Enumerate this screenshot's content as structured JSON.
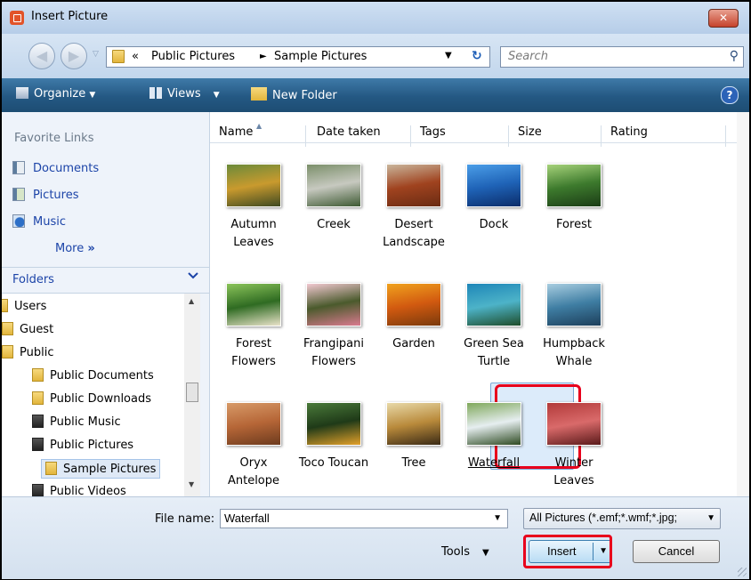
{
  "window": {
    "title": "Insert Picture",
    "close_glyph": "✕"
  },
  "address": {
    "prefix": "«",
    "crumbs": [
      "Public Pictures",
      "Sample Pictures"
    ],
    "separator": "►",
    "search_placeholder": "Search"
  },
  "toolbar": {
    "organize": "Organize",
    "views": "Views",
    "new_folder": "New Folder",
    "help": "?"
  },
  "sidebar": {
    "favorites_title": "Favorite Links",
    "favorites": [
      {
        "label": "Documents",
        "icon": "documents-icon"
      },
      {
        "label": "Pictures",
        "icon": "pictures-icon"
      },
      {
        "label": "Music",
        "icon": "music-icon"
      }
    ],
    "more": "More",
    "more_glyph": "»",
    "folders_title": "Folders",
    "tree": [
      {
        "label": "Users",
        "level": 0
      },
      {
        "label": "Guest",
        "level": 1
      },
      {
        "label": "Public",
        "level": 1
      },
      {
        "label": "Public Documents",
        "level": 2
      },
      {
        "label": "Public Downloads",
        "level": 2
      },
      {
        "label": "Public Music",
        "level": 2
      },
      {
        "label": "Public Pictures",
        "level": 2
      },
      {
        "label": "Sample Pictures",
        "level": 3,
        "selected": true
      },
      {
        "label": "Public Videos",
        "level": 2
      }
    ]
  },
  "columns": [
    "Name",
    "Date taken",
    "Tags",
    "Size",
    "Rating"
  ],
  "files": [
    {
      "label": "Autumn Leaves",
      "colors": [
        "#6b8a3a",
        "#c99a2e",
        "#3f4a22"
      ]
    },
    {
      "label": "Creek",
      "colors": [
        "#7b8f6a",
        "#c7c9c0",
        "#3e5a33"
      ]
    },
    {
      "label": "Desert Landscape",
      "colors": [
        "#c9b59b",
        "#a0431f",
        "#6a2b13"
      ]
    },
    {
      "label": "Dock",
      "colors": [
        "#4b9ee8",
        "#1f63b7",
        "#0b2d6a"
      ]
    },
    {
      "label": "Forest",
      "colors": [
        "#a6d27a",
        "#3d7a2d",
        "#1b3c16"
      ]
    },
    {
      "label": "Forest Flowers",
      "colors": [
        "#8bc45a",
        "#2f6b22",
        "#e9e2c9"
      ]
    },
    {
      "label": "Frangipani Flowers",
      "colors": [
        "#f2c9d1",
        "#4a5a2c",
        "#d97a8f"
      ]
    },
    {
      "label": "Garden",
      "colors": [
        "#f0a21e",
        "#d25a10",
        "#7a3a0c"
      ]
    },
    {
      "label": "Green Sea Turtle",
      "colors": [
        "#1e86b8",
        "#4db3c8",
        "#1e4d2a"
      ]
    },
    {
      "label": "Humpback Whale",
      "colors": [
        "#a8cde0",
        "#3f7ea3",
        "#1d3f5b"
      ]
    },
    {
      "label": "Oryx Antelope",
      "colors": [
        "#d79a68",
        "#b66637",
        "#6d3b1e"
      ]
    },
    {
      "label": "Toco Toucan",
      "colors": [
        "#4a7a3a",
        "#1f3a18",
        "#e2a02a"
      ]
    },
    {
      "label": "Tree",
      "colors": [
        "#e8d9a8",
        "#b98a3b",
        "#3a2a15"
      ]
    },
    {
      "label": "Waterfall",
      "colors": [
        "#7fa85a",
        "#e6eef0",
        "#2e4a22"
      ],
      "selected": true
    },
    {
      "label": "Winter Leaves",
      "colors": [
        "#b23a3a",
        "#d96a6a",
        "#5a1a1a"
      ]
    }
  ],
  "bottom": {
    "filename_label": "File name:",
    "filename_value": "Waterfall",
    "filetype": "All Pictures (*.emf;*.wmf;*.jpg;",
    "tools": "Tools",
    "insert": "Insert",
    "cancel": "Cancel",
    "dropdown_glyph": "▼"
  }
}
